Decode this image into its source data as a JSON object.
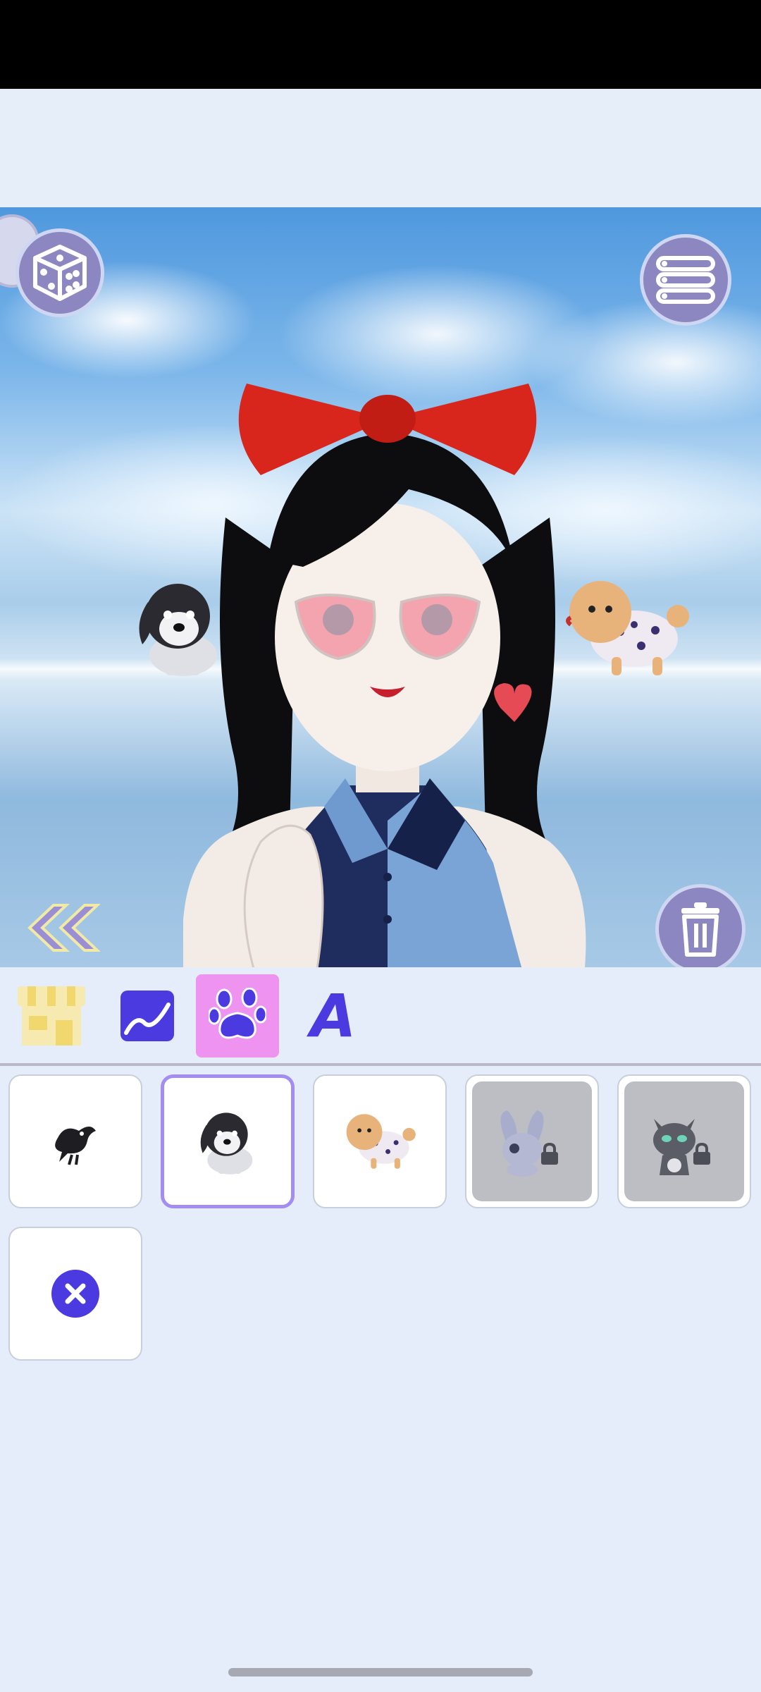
{
  "app": {
    "screen": "pet-accessories-editor"
  },
  "toolbar": {
    "dice_icon": "dice-icon",
    "menu_icon": "list-menu-icon",
    "trash_icon": "trash-icon",
    "collapse_icon": "double-chevron-left-icon"
  },
  "tabs": [
    {
      "name": "shop",
      "icon": "shop-icon",
      "selected": false
    },
    {
      "name": "background",
      "icon": "landscape-icon",
      "selected": false
    },
    {
      "name": "pets",
      "icon": "paw-icon",
      "selected": true
    },
    {
      "name": "text",
      "label": "A",
      "selected": false
    }
  ],
  "items": [
    {
      "name": "crow",
      "icon": "crow-icon",
      "selected": false,
      "locked": false
    },
    {
      "name": "husky-puppy",
      "icon": "dog-icon",
      "selected": true,
      "locked": false
    },
    {
      "name": "pomeranian",
      "icon": "pomeranian-icon",
      "selected": false,
      "locked": false
    },
    {
      "name": "bunny",
      "icon": "bunny-icon",
      "selected": false,
      "locked": true
    },
    {
      "name": "cat",
      "icon": "cat-icon",
      "selected": false,
      "locked": true
    },
    {
      "name": "none",
      "icon": "close-icon",
      "selected": false,
      "locked": false
    }
  ],
  "colors": {
    "accent": "#4a3ae0",
    "selected_tab": "#ee93ef",
    "selected_border": "#a48df0",
    "button_fill": "#8c87c0"
  }
}
